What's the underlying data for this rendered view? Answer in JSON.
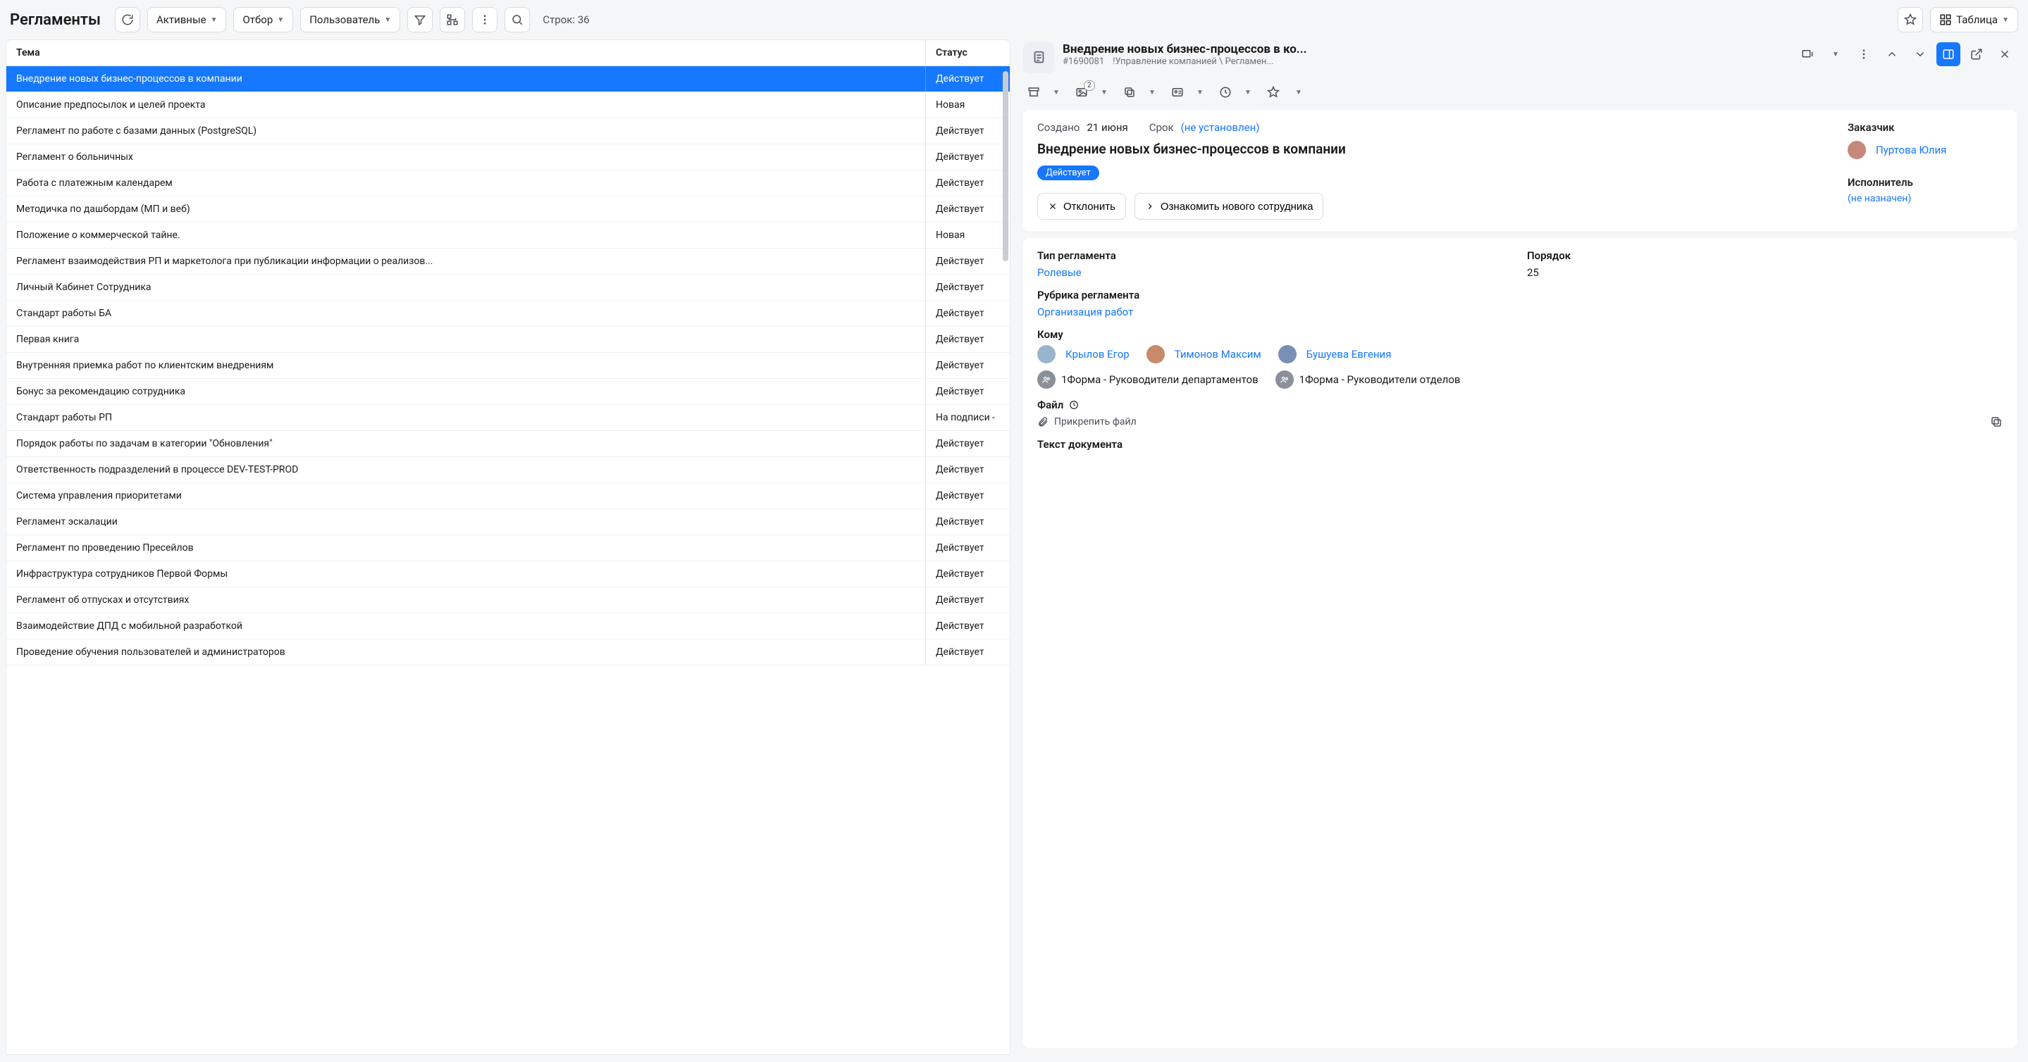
{
  "header": {
    "title": "Регламенты",
    "filters": {
      "active": "Активные",
      "selection": "Отбор",
      "user": "Пользователь"
    },
    "row_count_label": "Строк:",
    "row_count_value": "36",
    "view_label": "Таблица"
  },
  "table": {
    "col_topic": "Тема",
    "col_status": "Статус",
    "rows": [
      {
        "topic": "Внедрение новых бизнес-процессов в компании",
        "status": "Действует",
        "selected": true
      },
      {
        "topic": "Описание предпосылок и целей проекта",
        "status": "Новая"
      },
      {
        "topic": "Регламент по работе с базами данных (PostgreSQL)",
        "status": "Действует"
      },
      {
        "topic": "Регламент о больничных",
        "status": "Действует"
      },
      {
        "topic": "Работа с платежным календарем",
        "status": "Действует"
      },
      {
        "topic": "Методичка по дашбордам (МП и веб)",
        "status": "Действует"
      },
      {
        "topic": "Положение о коммерческой тайне.",
        "status": "Новая"
      },
      {
        "topic": "Регламент взаимодействия РП и маркетолога при публикации информации о реализов...",
        "status": "Действует"
      },
      {
        "topic": "Личный Кабинет Сотрудника",
        "status": "Действует"
      },
      {
        "topic": "Стандарт работы БА",
        "status": "Действует"
      },
      {
        "topic": "Первая книга",
        "status": "Действует"
      },
      {
        "topic": "Внутренняя приемка работ по клиентским внедрениям",
        "status": "Действует"
      },
      {
        "topic": "Бонус за рекомендацию сотрудника",
        "status": "Действует"
      },
      {
        "topic": "Стандарт работы РП",
        "status": "На подписи -"
      },
      {
        "topic": "Порядок работы по задачам в категории \"Обновления\"",
        "status": "Действует"
      },
      {
        "topic": "Ответственность подразделений в процессе DEV-TEST-PROD",
        "status": "Действует"
      },
      {
        "topic": "Система управления приоритетами",
        "status": "Действует"
      },
      {
        "topic": "Регламент эскалации",
        "status": "Действует"
      },
      {
        "topic": "Регламент по проведению Пресейлов",
        "status": "Действует"
      },
      {
        "topic": "Инфраструктура сотрудников Первой Формы",
        "status": "Действует"
      },
      {
        "topic": "Регламент об отпусках и отсутствиях",
        "status": "Действует"
      },
      {
        "topic": "Взаимодействие ДПД с мобильной разработкой",
        "status": "Действует"
      },
      {
        "topic": "Проведение обучения пользователей и администраторов",
        "status": "Действует"
      }
    ]
  },
  "detail": {
    "header_title": "Внедрение новых бизнес-процессов в ко...",
    "header_id": "#1690081",
    "header_breadcrumb": "!Управление компанией \\ Регламен...",
    "toolbar_badge": "2",
    "created_label": "Создано",
    "created_value": "21 июня",
    "deadline_label": "Срок",
    "deadline_value": "(не установлен)",
    "title": "Внедрение новых бизнес-процессов в компании",
    "status": "Действует",
    "customer_label": "Заказчик",
    "customer_name": "Пуртова Юлия",
    "executor_label": "Исполнитель",
    "executor_value": "(не назначен)",
    "btn_reject": "Отклонить",
    "btn_acquaint": "Ознакомить нового сотрудника",
    "fields": {
      "type_label": "Тип регламента",
      "type_value": "Ролевые",
      "order_label": "Порядок",
      "order_value": "25",
      "rubric_label": "Рубрика регламента",
      "rubric_value": "Организация работ",
      "towhom_label": "Кому",
      "people": [
        {
          "name": "Крылов Егор"
        },
        {
          "name": "Тимонов Максим"
        },
        {
          "name": "Бушуева Евгения"
        }
      ],
      "groups": [
        {
          "name": "1Форма - Руководители департаментов"
        },
        {
          "name": "1Форма - Руководители отделов"
        }
      ],
      "file_label": "Файл",
      "file_attach": "Прикрепить файл",
      "text_label": "Текст документа"
    }
  }
}
